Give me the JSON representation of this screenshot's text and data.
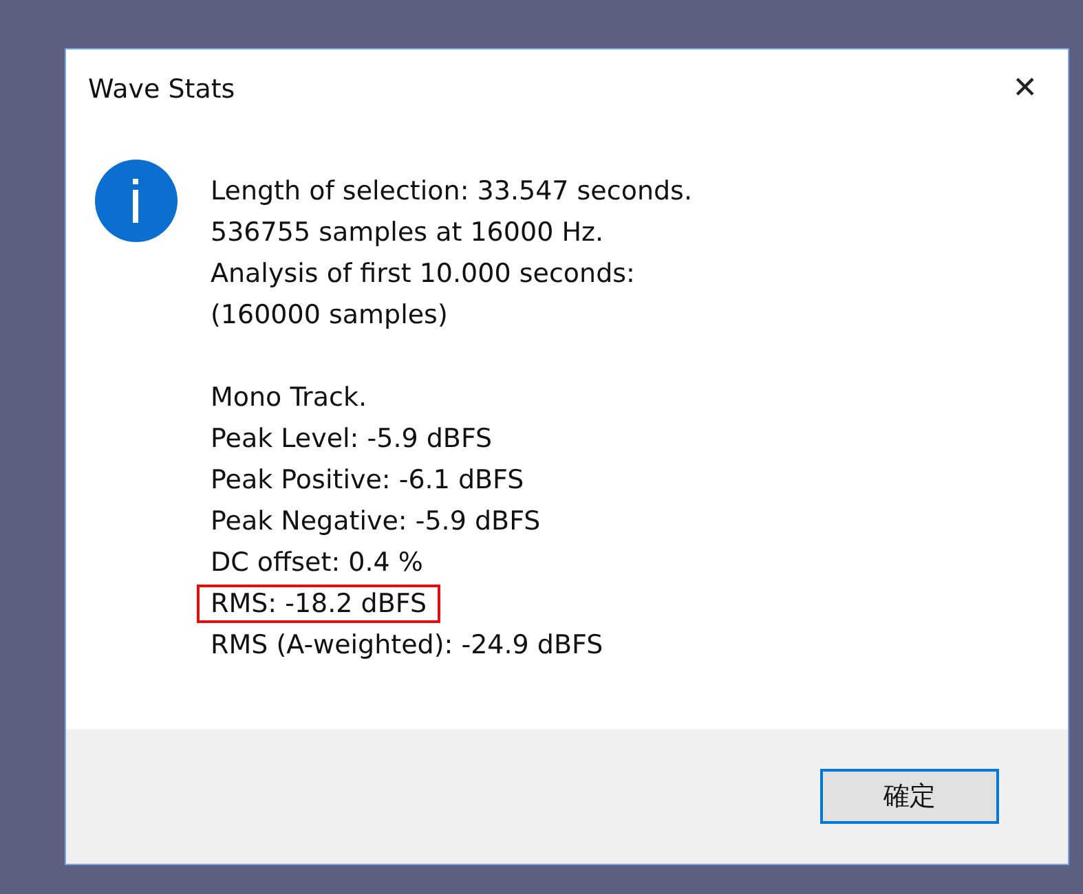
{
  "window": {
    "title": "Wave Stats",
    "close": "✕"
  },
  "message_groups": [
    {
      "lines": [
        {
          "text": "Length of selection: 33.547 seconds.",
          "highlighted": false
        },
        {
          "text": "536755 samples at 16000 Hz.",
          "highlighted": false
        },
        {
          "text": "Analysis of first 10.000 seconds:",
          "highlighted": false
        },
        {
          "text": "(160000 samples)",
          "highlighted": false
        }
      ]
    },
    {
      "lines": [
        {
          "text": "Mono Track.",
          "highlighted": false
        },
        {
          "text": "Peak Level: -5.9 dBFS",
          "highlighted": false
        },
        {
          "text": "Peak Positive: -6.1 dBFS",
          "highlighted": false
        },
        {
          "text": "Peak Negative: -5.9 dBFS",
          "highlighted": false
        },
        {
          "text": "DC offset: 0.4 %",
          "highlighted": false
        },
        {
          "text": "RMS: -18.2 dBFS",
          "highlighted": true
        },
        {
          "text": "RMS (A-weighted): -24.9 dBFS",
          "highlighted": false
        }
      ]
    }
  ],
  "buttons": [
    {
      "label": "確定",
      "selected": true
    }
  ]
}
